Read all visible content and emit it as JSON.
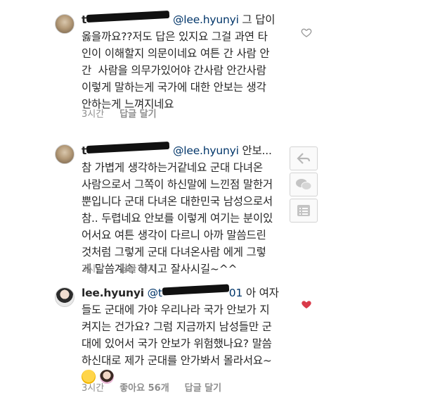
{
  "comments": [
    {
      "username": "t",
      "mention": "@lee.hyunyi",
      "body": " 그 답이\n옳을까요??저도 답은 있지요 그걸 과연 타\n인이 이해할지 의문이네요 여튼 간 사람 안\n간  사람을 의무가있어야 간사람 안간사람\n이렇게 말하는게 국가에 대한 안보는 생각\n안하는게 느껴지네요",
      "time": "3시간",
      "reply": "답글 달기"
    },
    {
      "username": "t",
      "mention": "@lee.hyunyi",
      "body": " 안보...\n참 가볍게 생각하는거같네요 군대 다녀온\n사람으로서 그쪽이 하신말에 느낀점 말한거\n뿐입니다 군대 다녀온 대한민국 남성으로서\n참.. 두렵네요 안보를 이렇게 여기는 분이있\n어서요 여튼 생각이 다르니 아까 말씀드린\n것처럼 그렇게 군대 다녀온사람 에게 그렇\n게 말씀계속 하시고 잘사시길~^^",
      "time": "3시간",
      "reply": "답글 달기"
    },
    {
      "username": "lee.hyunyi",
      "mention": "@t",
      "tail": "01",
      "body": " 아 여자\n들도 군대에 가야 우리나라 국가 안보가 지\n켜지는 건가요? 그럼 지금까지 남성들만 군\n대에 있어서 국가 안보가 위험했나요? 말씀\n하신대로 제가 군대를 안가봐서 몰라서요~",
      "time": "3시간",
      "likes": "좋아요 56개",
      "reply": "답글 달기"
    }
  ],
  "colors": {
    "text": "#262626",
    "mention": "#003569",
    "meta": "#8e8e8e",
    "liked_heart": "#d93a4a"
  }
}
